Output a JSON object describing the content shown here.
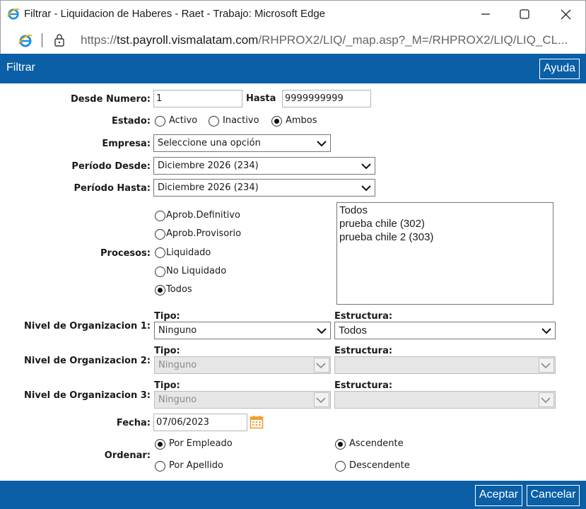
{
  "window": {
    "title": "Filtrar - Liquidacion de Haberes - Raet - Trabajo: Microsoft Edge"
  },
  "addressbar": {
    "url_prefix": "https://",
    "url_host": "tst.payroll.vismalatam.com",
    "url_path": "/RHPROX2/LIQ/_map.asp?_M=/RHPROX2/LIQ/LIQ_CL..."
  },
  "header": {
    "title": "Filtrar",
    "help_label": "Ayuda"
  },
  "form": {
    "desde_numero": {
      "label": "Desde Numero:",
      "value": "1"
    },
    "hasta": {
      "label": "Hasta",
      "value": "9999999999"
    },
    "estado": {
      "label": "Estado:",
      "options": [
        "Activo",
        "Inactivo",
        "Ambos"
      ],
      "selected": "Ambos"
    },
    "empresa": {
      "label": "Empresa:",
      "value": "Seleccione una opción"
    },
    "periodo_desde": {
      "label": "Período Desde:",
      "value": "Diciembre 2026 (234)"
    },
    "periodo_hasta": {
      "label": "Período Hasta:",
      "value": "Diciembre 2026 (234)"
    },
    "procesos": {
      "label": "Procesos:",
      "options": [
        "Aprob.Definitivo",
        "Aprob.Provisorio",
        "Liquidado",
        "No Liquidado",
        "Todos"
      ],
      "selected": "Todos",
      "list": [
        "Todos",
        "prueba chile (302)",
        "prueba chile 2 (303)"
      ]
    },
    "niveles": [
      {
        "label": "Nivel de Organizacion 1:",
        "tipo_label": "Tipo:",
        "tipo_value": "Ninguno",
        "estructura_label": "Estructura:",
        "estructura_value": "Todos"
      },
      {
        "label": "Nivel de Organizacion 2:",
        "tipo_label": "Tipo:",
        "tipo_value": "Ninguno",
        "estructura_label": "Estructura:",
        "estructura_value": ""
      },
      {
        "label": "Nivel de Organizacion 3:",
        "tipo_label": "Tipo:",
        "tipo_value": "Ninguno",
        "estructura_label": "Estructura:",
        "estructura_value": ""
      }
    ],
    "fecha": {
      "label": "Fecha:",
      "value": "07/06/2023"
    },
    "ordenar": {
      "label": "Ordenar:",
      "by_options": [
        "Por Empleado",
        "Por Apellido"
      ],
      "by_selected": "Por Empleado",
      "dir_options": [
        "Ascendente",
        "Descendente"
      ],
      "dir_selected": "Ascendente"
    }
  },
  "footer": {
    "accept_label": "Aceptar",
    "cancel_label": "Cancelar"
  },
  "colors": {
    "brand_blue": "#0a5fa6",
    "calendar_orange": "#f0a030"
  }
}
